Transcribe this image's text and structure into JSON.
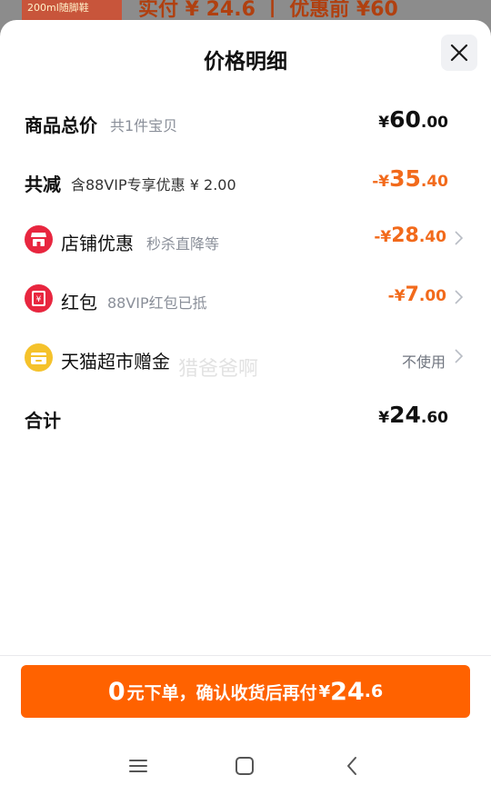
{
  "peek": {
    "thumb_text": "200ml随脚鞋",
    "text": "实付 ¥ 24.6 丨 优惠前 ¥60"
  },
  "sheet": {
    "title": "价格明细",
    "close_icon": "close-icon"
  },
  "rows": {
    "total": {
      "label": "商品总价",
      "sub": "共1件宝贝",
      "currency": "¥",
      "int": "60",
      "dec": ".00"
    },
    "reduced": {
      "label": "共减",
      "sub": "含88VIP专享优惠 ¥ 2.00",
      "currency": "-¥",
      "int": "35",
      "dec": ".40"
    },
    "store": {
      "label": "店铺优惠",
      "sub": "秒杀直降等",
      "currency": "-¥",
      "int": "28",
      "dec": ".40",
      "icon": "store-icon"
    },
    "redpacket": {
      "label": "红包",
      "sub": "88VIP红包已抵",
      "currency": "-¥",
      "int": "7",
      "dec": ".00",
      "icon": "red-packet-icon"
    },
    "tmall": {
      "label": "天猫超市赠金",
      "value": "不使用",
      "icon": "wallet-icon"
    },
    "sum": {
      "label": "合计",
      "currency": "¥",
      "int": "24",
      "dec": ".60"
    }
  },
  "watermark": "猎爸爸啊",
  "cta": {
    "big": "0",
    "text": "元下单，确认收货后再付",
    "currency": "¥",
    "int": "24",
    "dec": ".6"
  },
  "navbar": {
    "menu_icon": "menu-icon",
    "home_icon": "home-icon",
    "back_icon": "back-icon"
  },
  "colors": {
    "accent": "#ff6200",
    "discount": "#f26a1b",
    "store_icon_bg": "#e8263f",
    "redpacket_icon_bg": "#e8263f",
    "wallet_icon_bg": "#f5c22b"
  }
}
